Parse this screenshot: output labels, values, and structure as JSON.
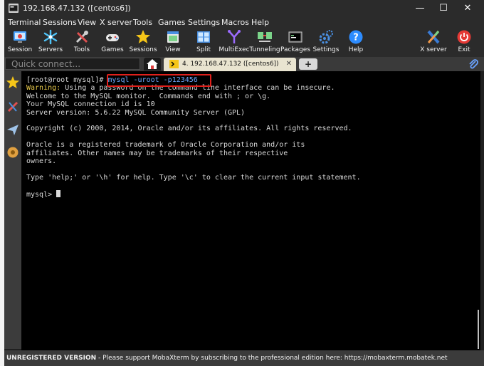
{
  "window": {
    "title": "192.168.47.132 ([centos6])"
  },
  "window_controls": {
    "minimize": "—",
    "maximize": "☐",
    "close": "✕"
  },
  "menu": [
    "Terminal",
    "Sessions",
    "View",
    "X server",
    "Tools",
    "Games",
    "Settings",
    "Macros",
    "Help"
  ],
  "toolbar": {
    "session": "Session",
    "servers": "Servers",
    "tools": "Tools",
    "games": "Games",
    "sessions": "Sessions",
    "view": "View",
    "split": "Split",
    "multiexec": "MultiExec",
    "tunneling": "Tunneling",
    "packages": "Packages",
    "settings": "Settings",
    "help": "Help",
    "xserver": "X server",
    "exit": "Exit"
  },
  "tabs": {
    "quick_connect_placeholder": "Quick connect...",
    "session_tab": "4. 192.168.47.132 ([centos6])",
    "session_close": "✕",
    "new_tab": "+"
  },
  "terminal": {
    "prompt": "[root@root mysql]# ",
    "command": "mysql -uroot -p123456",
    "warning_label": "Warning:",
    "warning_text": " Using a password on the command line interface can be insecure.",
    "lines": [
      "Welcome to the MySQL monitor.  Commands end with ; or \\g.",
      "Your MySQL connection id is 10",
      "Server version: 5.6.22 MySQL Community Server (GPL)",
      "",
      "Copyright (c) 2000, 2014, Oracle and/or its affiliates. All rights reserved.",
      "",
      "Oracle is a registered trademark of Oracle Corporation and/or its",
      "affiliates. Other names may be trademarks of their respective",
      "owners.",
      "",
      "Type 'help;' or '\\h' for help. Type '\\c' to clear the current input statement.",
      ""
    ],
    "mysql_prompt": "mysql> "
  },
  "status": {
    "bold": "UNREGISTERED VERSION",
    "text": "  -  Please support MobaXterm by subscribing to the professional edition here:  https://mobaxterm.mobatek.net"
  },
  "colors": {
    "accent_red": "#e0201b",
    "warning": "#e6c84a",
    "command": "#6fa8ff"
  }
}
